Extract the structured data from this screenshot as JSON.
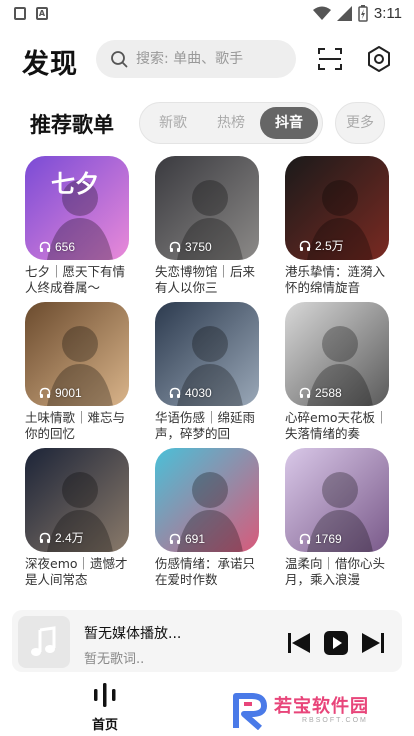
{
  "status_bar": {
    "time": "3:11",
    "left_icon_letter": "A"
  },
  "header": {
    "title": "发现",
    "search_placeholder": "搜索: 单曲、歌手"
  },
  "section": {
    "title": "推荐歌单",
    "tabs": [
      "新歌",
      "热榜",
      "抖音"
    ],
    "active_tab": "抖音",
    "more": "更多"
  },
  "playlists": [
    {
      "count": "656",
      "title": "七夕｜愿天下有情人终成眷属～",
      "cover_text": "七夕",
      "c1": "#7a4bd6",
      "c2": "#e98ad8"
    },
    {
      "count": "3750",
      "title": "失恋博物馆｜后来有人以你三",
      "c1": "#3a3a3f",
      "c2": "#8c8a88"
    },
    {
      "count": "2.5万",
      "title": "港乐挚情：涟漪入怀的绵情旋音",
      "c1": "#1a1a1a",
      "c2": "#7a2a22"
    },
    {
      "count": "9001",
      "title": "土味情歌｜难忘与你的回忆",
      "c1": "#6b4b2e",
      "c2": "#d9b48a"
    },
    {
      "count": "4030",
      "title": "华语伤感｜绵延雨声，碎梦的回",
      "c1": "#2c3a4e",
      "c2": "#9aa8b8"
    },
    {
      "count": "2588",
      "title": "心碎emo天花板｜失落情绪的奏",
      "c1": "#d8d8d8",
      "c2": "#5a5a5a"
    },
    {
      "count": "2.4万",
      "title": "深夜emo｜遗憾才是人间常态",
      "c1": "#1c2438",
      "c2": "#8a7a6a"
    },
    {
      "count": "691",
      "title": "伤感情绪：承诺只在爱时作数",
      "c1": "#4ac0d8",
      "c2": "#d85a7a"
    },
    {
      "count": "1769",
      "title": "温柔向｜借你心头月，乘入浪漫",
      "c1": "#d9c8e8",
      "c2": "#7a5a8a"
    }
  ],
  "player": {
    "title": "暂无媒体播放...",
    "subtitle": "暂无歌词.."
  },
  "nav": {
    "home_label": "首页"
  },
  "watermark": {
    "text": "若宝软件园",
    "sub": "RBSOFT.COM"
  }
}
